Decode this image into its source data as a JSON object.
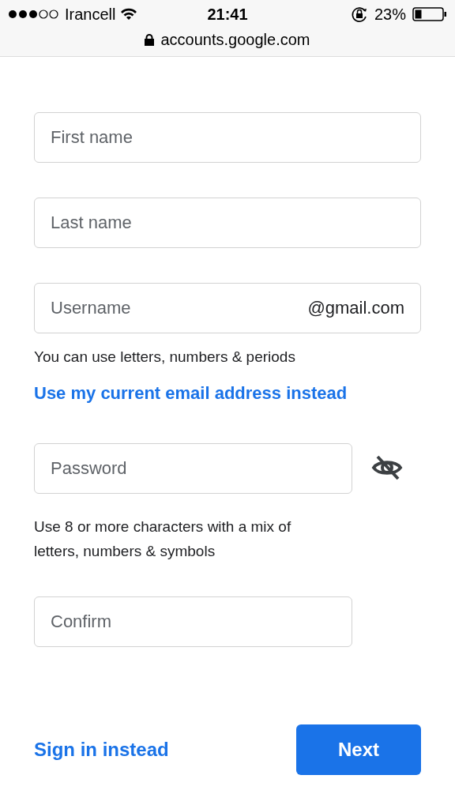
{
  "status_bar": {
    "carrier": "Irancell",
    "time": "21:41",
    "battery": "23%",
    "url": "accounts.google.com"
  },
  "fields": [
    {
      "placeholder": "First name"
    },
    {
      "placeholder": "Last name"
    },
    {
      "placeholder": "Username",
      "suffix": "@gmail.com",
      "hint": "You can use letters, numbers & periods",
      "link": "Use my current email address instead"
    },
    {
      "placeholder": "Password",
      "password_hidden": true,
      "hint": "Use 8 or more characters with a mix of letters, numbers & symbols"
    },
    {
      "placeholder": "Confirm"
    }
  ],
  "actions": {
    "secondary": "Sign in instead",
    "primary": "Next"
  }
}
